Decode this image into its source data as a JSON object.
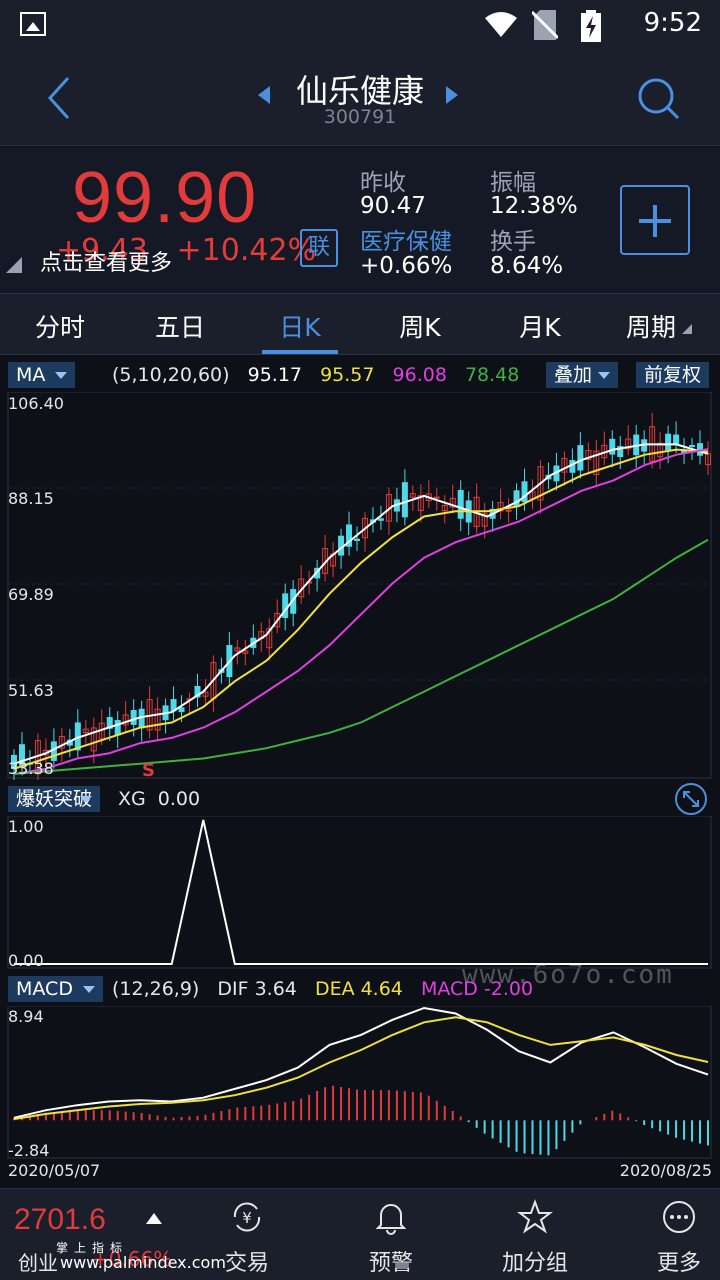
{
  "status_bar": {
    "time": "9:52"
  },
  "header": {
    "title": "仙乐健康",
    "code": "300791"
  },
  "quote": {
    "price": "99.90",
    "change": "+9.43",
    "change_pct": "+10.42%",
    "more_label": "点击查看更多",
    "link_label": "联",
    "prev_close_label": "昨收",
    "prev_close": "90.47",
    "amplitude_label": "振幅",
    "amplitude": "12.38%",
    "sector_label": "医疗保健",
    "sector_change": "+0.66%",
    "turnover_label": "换手",
    "turnover": "8.64%"
  },
  "tabs": [
    {
      "label": "分时"
    },
    {
      "label": "五日"
    },
    {
      "label": "日K"
    },
    {
      "label": "周K"
    },
    {
      "label": "月K"
    },
    {
      "label": "周期"
    }
  ],
  "ma_legend": {
    "selector": "MA",
    "params": "(5,10,20,60)",
    "v5": "95.17",
    "v10": "95.57",
    "v20": "96.08",
    "v60": "78.48",
    "overlay_label": "叠加",
    "adjust_label": "前复权"
  },
  "kline_axis": [
    "106.40",
    "88.15",
    "69.89",
    "51.63",
    "33.38"
  ],
  "signal_marker": "S",
  "xg_legend": {
    "selector": "爆妖突破",
    "label": "XG",
    "value": "0.00"
  },
  "xg_axis": [
    "1.00",
    "0.00"
  ],
  "macd_legend": {
    "selector": "MACD",
    "params": "(12,26,9)",
    "dif_label": "DIF",
    "dif": "3.64",
    "dea_label": "DEA",
    "dea": "4.64",
    "macd_label": "MACD",
    "macd": "-2.00"
  },
  "macd_axis": [
    "8.94",
    "-2.84"
  ],
  "date_start": "2020/05/07",
  "date_end": "2020/08/25",
  "watermark": "www.6o7o.com",
  "bottom_bar": {
    "index_value": "2701.6",
    "index_name": "创业",
    "index_change": "+0.66%",
    "overlay_text": "掌上指标",
    "overlay_url": "www.palmindex.com",
    "nav": [
      {
        "label": "交易"
      },
      {
        "label": "预警"
      },
      {
        "label": "加分组"
      },
      {
        "label": "更多"
      }
    ]
  },
  "colors": {
    "up": "#e23b3b",
    "down": "#4fd8e8",
    "ma5": "#ffffff",
    "ma10": "#f0e040",
    "ma20": "#e040e0",
    "ma60": "#40b040",
    "accent": "#4a8fe0"
  },
  "chart_data": [
    {
      "type": "line",
      "title": "",
      "series": [
        {
          "name": "MA5",
          "values": [
            35,
            37,
            40,
            42,
            44,
            45,
            49,
            56,
            60,
            68,
            75,
            80,
            85,
            87,
            85,
            83,
            86,
            91,
            94,
            96,
            97,
            97,
            95.17
          ]
        },
        {
          "name": "MA10",
          "values": [
            34,
            36,
            38,
            40,
            42,
            43,
            46,
            51,
            55,
            61,
            68,
            74,
            79,
            83,
            84,
            84,
            85,
            88,
            91,
            93,
            95,
            96,
            95.57
          ]
        },
        {
          "name": "MA20",
          "values": [
            33,
            34,
            36,
            37,
            39,
            40,
            42,
            45,
            49,
            53,
            58,
            64,
            70,
            75,
            78,
            80,
            82,
            85,
            88,
            90,
            93,
            95,
            96.08
          ]
        },
        {
          "name": "MA60",
          "values": [
            33,
            33.5,
            34,
            34.5,
            35,
            35.5,
            36,
            37,
            38,
            39.5,
            41,
            43,
            46,
            49,
            52,
            55,
            58,
            61,
            64,
            67,
            71,
            75,
            78.48
          ]
        }
      ],
      "ylim": [
        33.38,
        106.4
      ]
    },
    {
      "type": "line",
      "series": [
        {
          "name": "XG",
          "values": [
            0,
            0,
            0,
            0,
            0,
            0,
            1,
            0,
            0,
            0,
            0,
            0,
            0,
            0,
            0,
            0,
            0,
            0,
            0,
            0,
            0,
            0,
            0
          ]
        }
      ],
      "ylim": [
        0,
        1
      ]
    },
    {
      "type": "bar",
      "series": [
        {
          "name": "DIF",
          "values": [
            0.2,
            0.8,
            1.2,
            1.5,
            1.6,
            1.5,
            1.8,
            2.5,
            3.2,
            4.2,
            6.0,
            6.8,
            8.0,
            8.94,
            8.5,
            7.2,
            5.5,
            4.6,
            6.2,
            7.0,
            5.8,
            4.5,
            3.64
          ]
        },
        {
          "name": "DEA",
          "values": [
            0.1,
            0.5,
            0.8,
            1.1,
            1.3,
            1.4,
            1.6,
            2.0,
            2.6,
            3.4,
            4.6,
            5.6,
            6.8,
            7.8,
            8.2,
            7.8,
            6.8,
            6.0,
            6.3,
            6.6,
            6.0,
            5.2,
            4.64
          ]
        },
        {
          "name": "MACD",
          "values": [
            0.2,
            0.6,
            0.8,
            0.8,
            0.6,
            0.2,
            0.4,
            1.0,
            1.2,
            1.6,
            2.8,
            2.4,
            2.4,
            2.2,
            0.6,
            -1.2,
            -2.6,
            -2.8,
            -0.2,
            0.8,
            -0.4,
            -1.4,
            -2.0
          ]
        }
      ],
      "ylim": [
        -2.84,
        8.94
      ]
    }
  ]
}
